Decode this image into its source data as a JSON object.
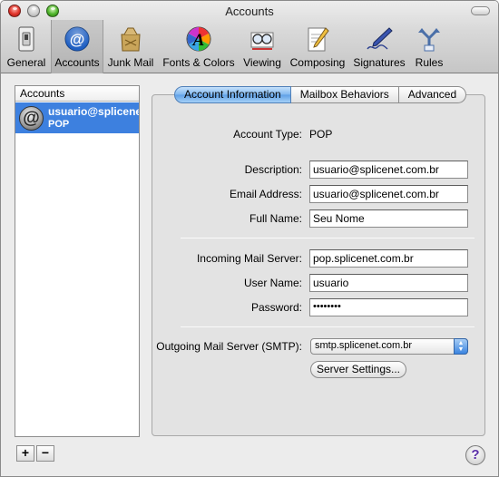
{
  "window": {
    "title": "Accounts"
  },
  "toolbar": {
    "items": [
      {
        "label": "General"
      },
      {
        "label": "Accounts"
      },
      {
        "label": "Junk Mail"
      },
      {
        "label": "Fonts & Colors"
      },
      {
        "label": "Viewing"
      },
      {
        "label": "Composing"
      },
      {
        "label": "Signatures"
      },
      {
        "label": "Rules"
      }
    ],
    "selected": "Accounts"
  },
  "accounts": {
    "header": "Accounts",
    "items": [
      {
        "name": "usuario@splicenet",
        "type": "POP",
        "icon": "at-sign-icon"
      }
    ],
    "add_label": "+",
    "remove_label": "−"
  },
  "tabs": [
    {
      "label": "Account Information",
      "active": true
    },
    {
      "label": "Mailbox Behaviors",
      "active": false
    },
    {
      "label": "Advanced",
      "active": false
    }
  ],
  "form": {
    "account_type_label": "Account Type:",
    "account_type_value": "POP",
    "description_label": "Description:",
    "description_value": "usuario@splicenet.com.br",
    "email_label": "Email Address:",
    "email_value": "usuario@splicenet.com.br",
    "fullname_label": "Full Name:",
    "fullname_value": "Seu Nome",
    "incoming_label": "Incoming Mail Server:",
    "incoming_value": "pop.splicenet.com.br",
    "username_label": "User Name:",
    "username_value": "usuario",
    "password_label": "Password:",
    "password_value": "••••••••",
    "outgoing_label": "Outgoing Mail Server (SMTP):",
    "outgoing_value": "smtp.splicenet.com.br",
    "server_settings_label": "Server Settings..."
  },
  "help": {
    "label": "?"
  },
  "colors": {
    "selection": "#3d80df",
    "active_tab": "#7fb7f0",
    "help_glyph": "#5a2ea8"
  }
}
